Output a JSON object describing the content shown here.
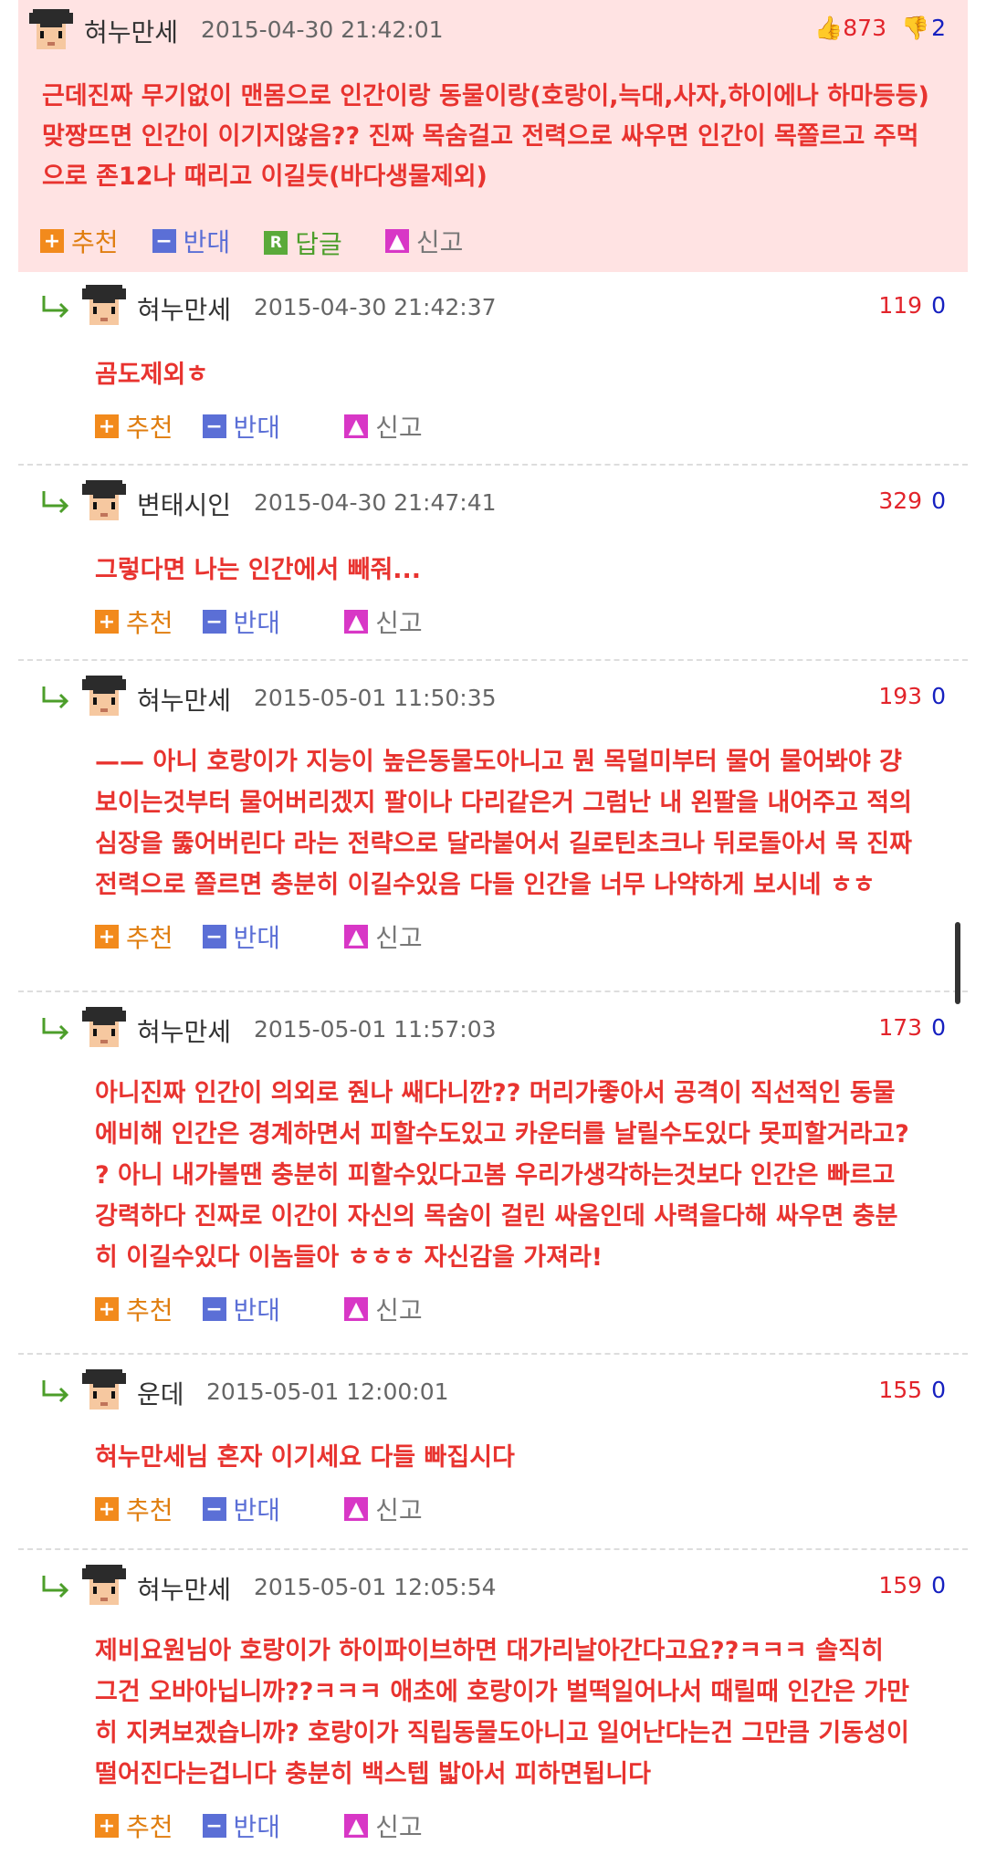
{
  "colors": {
    "post_bg": "#ffe3e3",
    "text_red": "#e8332f",
    "upvote": "#e2242b",
    "downvote": "#1620c0"
  },
  "actions": {
    "recommend": "추천",
    "oppose": "반대",
    "reply": "답글",
    "report": "신고"
  },
  "post": {
    "author": "혀누만세",
    "date": "2015-04-30 21:42:01",
    "up": "873",
    "down": "2",
    "text": "근데진짜 무기없이 맨몸으로 인간이랑 동물이랑(호랑이,늑대,사자,하이에나 하마등등)\n맞짱뜨면 인간이 이기지않음?? 진짜 목숨걸고 전력으로 싸우면 인간이 목쫄르고 주먹\n으로 존12나 때리고 이길듯(바다생물제외)"
  },
  "replies": [
    {
      "author": "혀누만세",
      "date": "2015-04-30 21:42:37",
      "up": "119",
      "down": "0",
      "text": "곰도제외ㅎ"
    },
    {
      "author": "변태시인",
      "date": "2015-04-30 21:47:41",
      "up": "329",
      "down": "0",
      "text": "그렇다면 나는 인간에서 빼줘..."
    },
    {
      "author": "혀누만세",
      "date": "2015-05-01 11:50:35",
      "up": "193",
      "down": "0",
      "text": "—— 아니 호랑이가 지능이 높은동물도아니고 뭔 목덜미부터 물어 물어봐야 걍\n보이는것부터 물어버리겠지 팔이나 다리같은거 그럼난 내 왼팔을 내어주고 적의\n심장을 뚫어버린다 라는 전략으로 달라붙어서 길로틴초크나 뒤로돌아서 목 진짜\n전력으로 쫄르면 충분히 이길수있음 다들 인간을 너무 나약하게 보시네 ㅎㅎ"
    },
    {
      "author": "혀누만세",
      "date": "2015-05-01 11:57:03",
      "up": "173",
      "down": "0",
      "text": "아니진짜 인간이 의외로 줜나 쌔다니깐?? 머리가좋아서 공격이 직선적인 동물\n에비해 인간은 경계하면서 피할수도있고 카운터를 날릴수도있다 못피할거라고?\n? 아니 내가볼땐 충분히 피할수있다고봄 우리가생각하는것보다 인간은 빠르고\n강력하다 진짜로 이간이 자신의 목숨이 걸린 싸움인데 사력을다해 싸우면 충분\n히 이길수있다 이놈들아 ㅎㅎㅎ 자신감을 가져라!"
    },
    {
      "author": "운데",
      "date": "2015-05-01 12:00:01",
      "up": "155",
      "down": "0",
      "text": "혀누만세님 혼자 이기세요 다들 빠집시다"
    },
    {
      "author": "혀누만세",
      "date": "2015-05-01 12:05:54",
      "up": "159",
      "down": "0",
      "text": "제비요원님아 호랑이가 하이파이브하면 대가리날아간다고요??ㅋㅋㅋ 솔직히\n그건 오바아닙니까??ㅋㅋㅋ 애초에 호랑이가 벌떡일어나서 때릴때 인간은 가만\n히 지켜보겠습니까? 호랑이가 직립동물도아니고 일어난다는건 그만큼 기동성이\n떨어진다는겁니다 충분히 백스텝 밟아서 피하면됩니다"
    }
  ]
}
